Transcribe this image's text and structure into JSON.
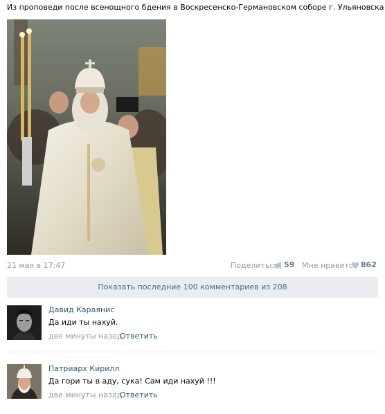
{
  "post": {
    "text": "Из проповеди после всенощного бдения в Воскресенско-Германовском соборе г. Ульяновска",
    "date": "21 мая в 17:47",
    "share_label": "Поделиться",
    "share_count": "59",
    "like_label": "Мне нравится",
    "like_count": "862"
  },
  "show_more": "Показать последние 100 комментариев из 208",
  "comments": [
    {
      "author": "Давид Караянис",
      "text": "Да иди ты нахуй.",
      "time": "две минуты назад",
      "separator": "|",
      "reply": "Ответить"
    },
    {
      "author": "Патриарх Кирилл",
      "text": "Да гори ты в аду, сука! Сам иди нахуй !!!",
      "time": "две минуты назад",
      "separator": "|",
      "reply": "Ответить"
    }
  ],
  "colors": {
    "link": "#2b587a",
    "muted": "#999999",
    "count": "#5f7a96",
    "button_bg": "#e9edf1"
  },
  "icons": {
    "share": "megaphone-icon",
    "like": "heart-icon"
  }
}
